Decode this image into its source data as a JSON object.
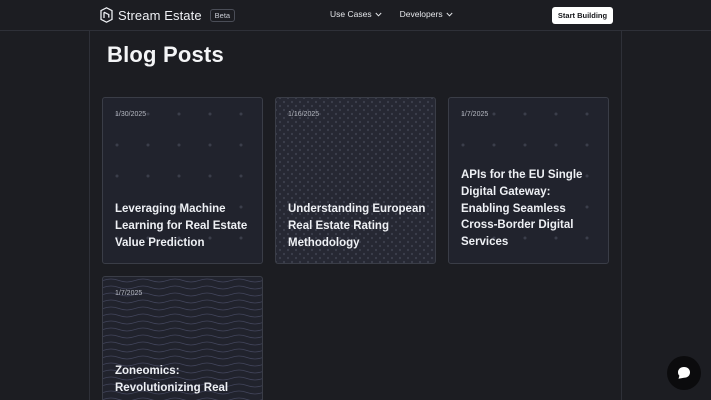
{
  "header": {
    "brand_name": "Stream Estate",
    "beta_label": "Beta",
    "nav": [
      {
        "label": "Use Cases",
        "icon": "chevron-down-icon"
      },
      {
        "label": "Developers",
        "icon": "chevron-down-icon"
      }
    ],
    "cta_label": "Start Building"
  },
  "page": {
    "title": "Blog Posts"
  },
  "posts": [
    {
      "date": "1/30/2025",
      "title": "Leveraging Machine Learning for Real Estate Value Prediction",
      "pattern": "dot-grid"
    },
    {
      "date": "1/16/2025",
      "title": "Understanding European Real Estate Rating Methodology",
      "pattern": "diamond-lattice"
    },
    {
      "date": "1/7/2025",
      "title": "APIs for the EU Single Digital Gateway: Enabling Seamless Cross-Border Digital Services",
      "pattern": "dot-grid"
    },
    {
      "date": "1/7/2025",
      "title": "Zoneomics: Revolutionizing Real",
      "pattern": "wave-lines"
    }
  ],
  "chat": {
    "icon": "chat-bubble-icon"
  },
  "colors": {
    "background": "#1c1d22",
    "card": "#21232d",
    "border": "#3a3d47",
    "cta": "#ffffff"
  }
}
